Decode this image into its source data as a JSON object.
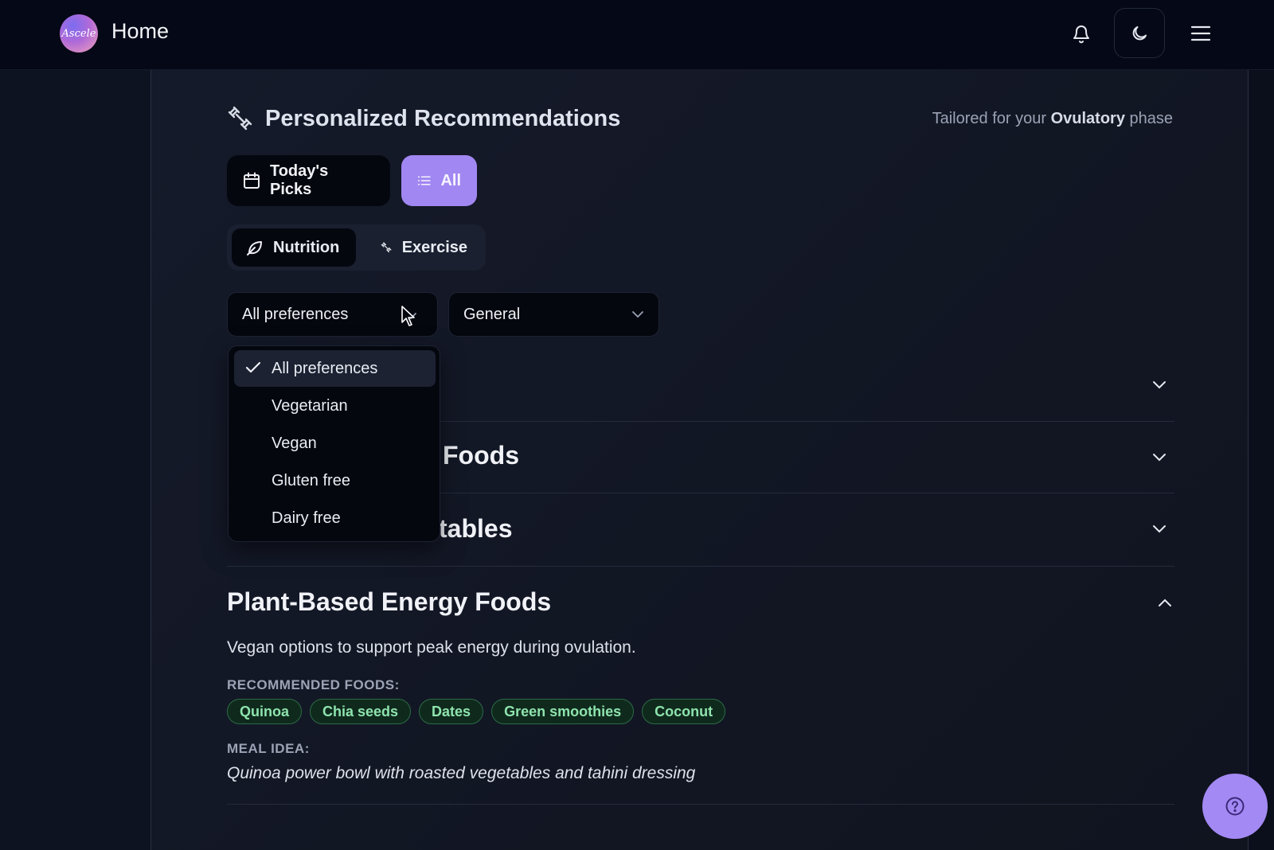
{
  "header": {
    "logo_text": "Ascele",
    "title": "Home",
    "icons": [
      "bell-icon",
      "moon-icon",
      "menu-icon"
    ]
  },
  "recommendations": {
    "title": "Personalized Recommendations",
    "tailored_prefix": "Tailored for your ",
    "phase": "Ovulatory",
    "tailored_suffix": " phase"
  },
  "view_tabs": [
    {
      "label": "Today's Picks",
      "icon": "calendar-icon",
      "active": false
    },
    {
      "label": "All",
      "icon": "list-icon",
      "active": true
    }
  ],
  "category_tabs": [
    {
      "label": "Nutrition",
      "icon": "leaf-icon",
      "active": true
    },
    {
      "label": "Exercise",
      "icon": "dumbbell-icon",
      "active": false
    }
  ],
  "filters": {
    "preference_value": "All preferences",
    "goal_value": "General"
  },
  "preference_options": [
    {
      "label": "All preferences",
      "selected": true
    },
    {
      "label": "Vegetarian",
      "selected": false
    },
    {
      "label": "Vegan",
      "selected": false
    },
    {
      "label": "Gluten free",
      "selected": false
    },
    {
      "label": "Dairy free",
      "selected": false
    }
  ],
  "accordion": [
    {
      "visible_title": "",
      "expanded": false
    },
    {
      "visible_title": "Foods",
      "expanded": false
    },
    {
      "visible_title": "tables",
      "expanded": false
    },
    {
      "visible_title": "Plant-Based Energy Foods",
      "expanded": true,
      "description": "Vegan options to support peak energy during ovulation.",
      "foods_label": "RECOMMENDED FOODS:",
      "foods": [
        "Quinoa",
        "Chia seeds",
        "Dates",
        "Green smoothies",
        "Coconut"
      ],
      "meal_label": "MEAL IDEA:",
      "meal": "Quinoa power bowl with roasted vegetables and tahini dressing"
    }
  ],
  "colors": {
    "accent": "#a187f2",
    "background": "#0a0f1d",
    "tag_text": "#8ee3ad",
    "tag_border": "#2c6b45"
  }
}
